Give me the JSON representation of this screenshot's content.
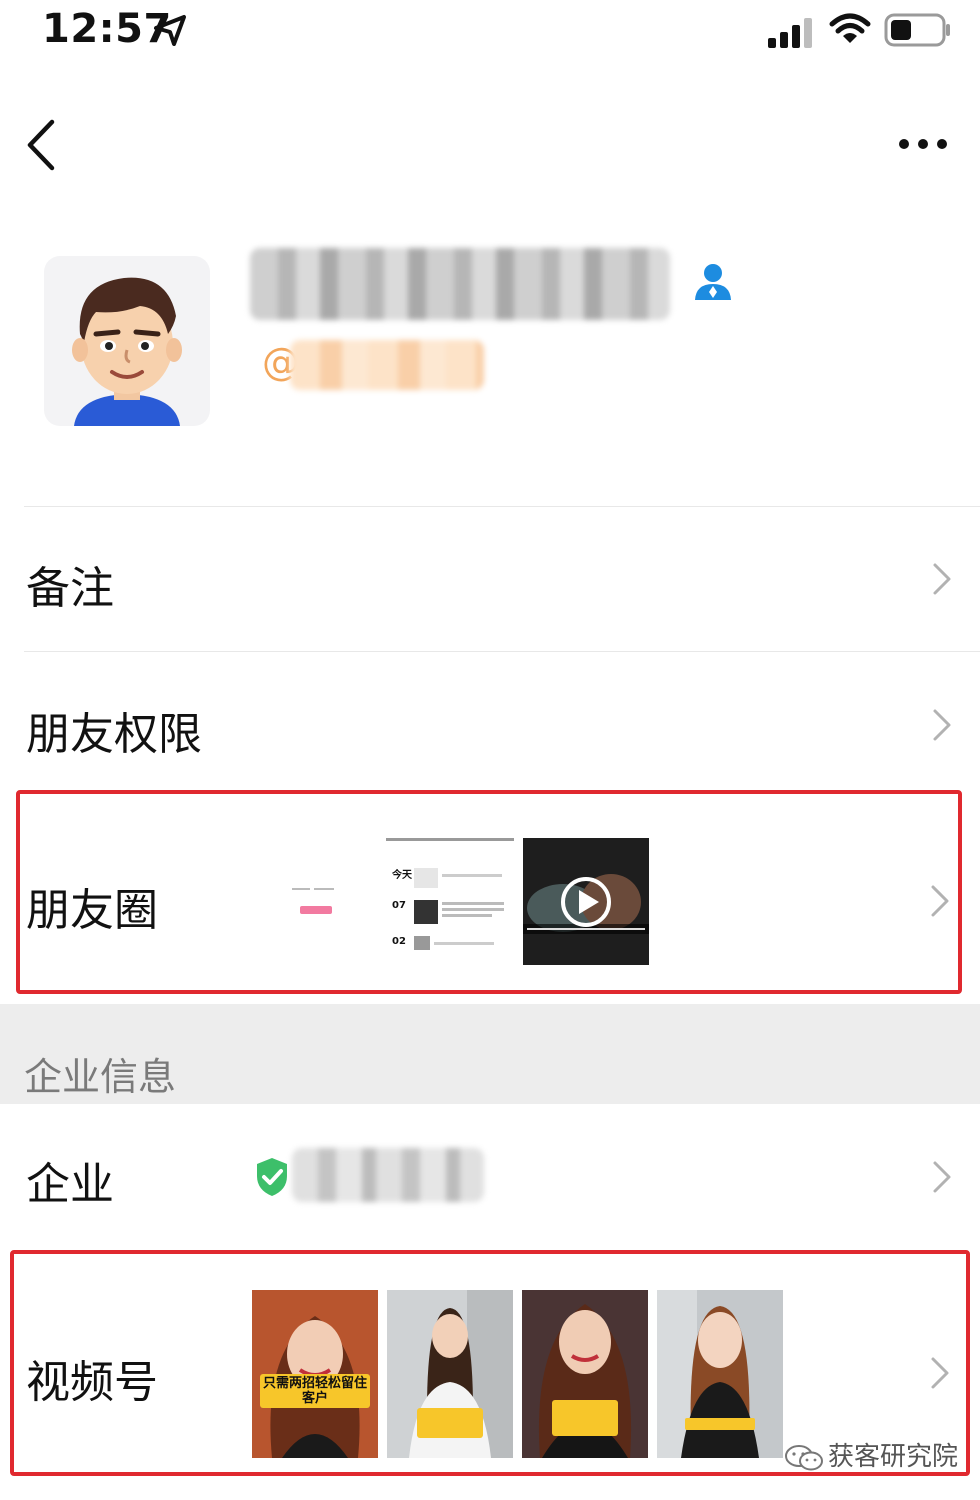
{
  "status_bar": {
    "time": "12:57"
  },
  "rows": {
    "remark": "备注",
    "friend_permissions": "朋友权限",
    "moments": "朋友圈",
    "company": "企业",
    "channels": "视频号"
  },
  "section": {
    "company_info": "企业信息"
  },
  "moments_preview": {
    "thumb2_today": "今天",
    "thumb2_d1": "07",
    "thumb2_d2": "02"
  },
  "channels_thumbs": [
    {
      "caption": "只需两招轻松留住客户"
    },
    {
      "caption": ""
    },
    {
      "caption": ""
    },
    {
      "caption": ""
    }
  ],
  "watermark": "获客研究院",
  "colors": {
    "highlight": "#e0292f",
    "badge_blue": "#1d8ce0",
    "shield_green": "#3dbf6a",
    "at_orange": "#f2a55a"
  }
}
